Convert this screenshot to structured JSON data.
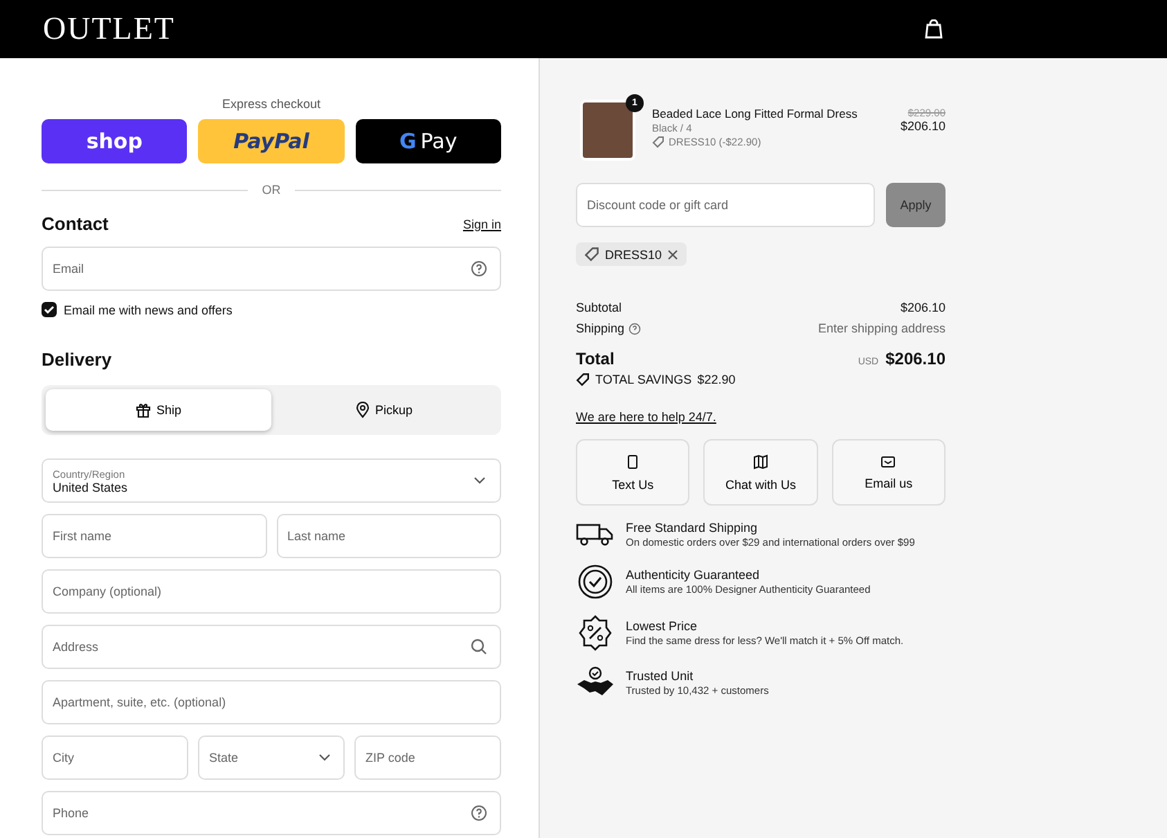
{
  "header": {
    "logo": "OUTLET"
  },
  "express": {
    "label": "Express checkout",
    "buttons": [
      {
        "kind": "shop",
        "label": "shop"
      },
      {
        "kind": "paypal",
        "label": "PayPal"
      },
      {
        "kind": "gpay",
        "mark": "G",
        "label": "Pay"
      }
    ],
    "divider": "OR"
  },
  "contact": {
    "title": "Contact",
    "sign_in": "Sign in",
    "email": {
      "placeholder": "Email"
    },
    "newsletter": {
      "label": "Email me with news and offers",
      "checked": true
    }
  },
  "delivery": {
    "title": "Delivery",
    "tabs": [
      {
        "kind": "box",
        "label": "Ship",
        "selected": true
      },
      {
        "kind": "pin",
        "label": "Pickup",
        "selected": false
      }
    ],
    "country": {
      "label": "Country/Region",
      "value": "United States"
    },
    "rows": [
      [
        {
          "kind": "text",
          "placeholder": "First name"
        },
        {
          "kind": "text",
          "placeholder": "Last name"
        }
      ],
      [
        {
          "kind": "text",
          "placeholder": "Company (optional)"
        }
      ],
      [
        {
          "kind": "search",
          "placeholder": "Address"
        }
      ],
      [
        {
          "kind": "text",
          "placeholder": "Apartment, suite, etc. (optional)"
        }
      ],
      [
        {
          "kind": "text",
          "placeholder": "City"
        },
        {
          "kind": "select",
          "placeholder": "State"
        },
        {
          "kind": "text",
          "placeholder": "ZIP code"
        }
      ],
      [
        {
          "kind": "help",
          "placeholder": "Phone"
        }
      ]
    ]
  },
  "summary": {
    "item": {
      "quantity": "1",
      "name": "Beaded Lace Long Fitted Formal Dress",
      "variant": "Black / 4",
      "discount": "DRESS10 (-$22.90)",
      "old_price": "$229.00",
      "price": "$206.10"
    },
    "discount_field": {
      "placeholder": "Discount code or gift card"
    },
    "apply": {
      "label": "Apply",
      "disabled": true
    },
    "code": "DRESS10",
    "subtotal": {
      "label": "Subtotal",
      "value": "$206.10"
    },
    "shipping": {
      "label": "Shipping",
      "value": "Enter shipping address"
    },
    "total": {
      "label": "Total",
      "currency": "USD",
      "value": "$206.10"
    },
    "savings": {
      "label": "TOTAL SAVINGS",
      "value": "$22.90"
    }
  },
  "help": {
    "link": "We are here to help 24/7.",
    "buttons": [
      {
        "kind": "phone",
        "label": "Text Us"
      },
      {
        "kind": "map",
        "label": "Chat with Us"
      },
      {
        "kind": "mail",
        "label": "Email us"
      }
    ]
  },
  "perks": [
    {
      "kind": "truck",
      "title": "Free Standard Shipping",
      "text": "On domestic orders over $29 and international orders over $99"
    },
    {
      "kind": "badge",
      "title": "Authenticity Guaranteed",
      "text": "All items are 100% Designer Authenticity Guaranteed"
    },
    {
      "kind": "percent",
      "title": "Lowest Price",
      "text": "Find the same dress for less? We'll match it + 5% Off match."
    },
    {
      "kind": "handshake",
      "title": "Trusted Unit",
      "text": "Trusted by 10,432 + customers"
    }
  ]
}
